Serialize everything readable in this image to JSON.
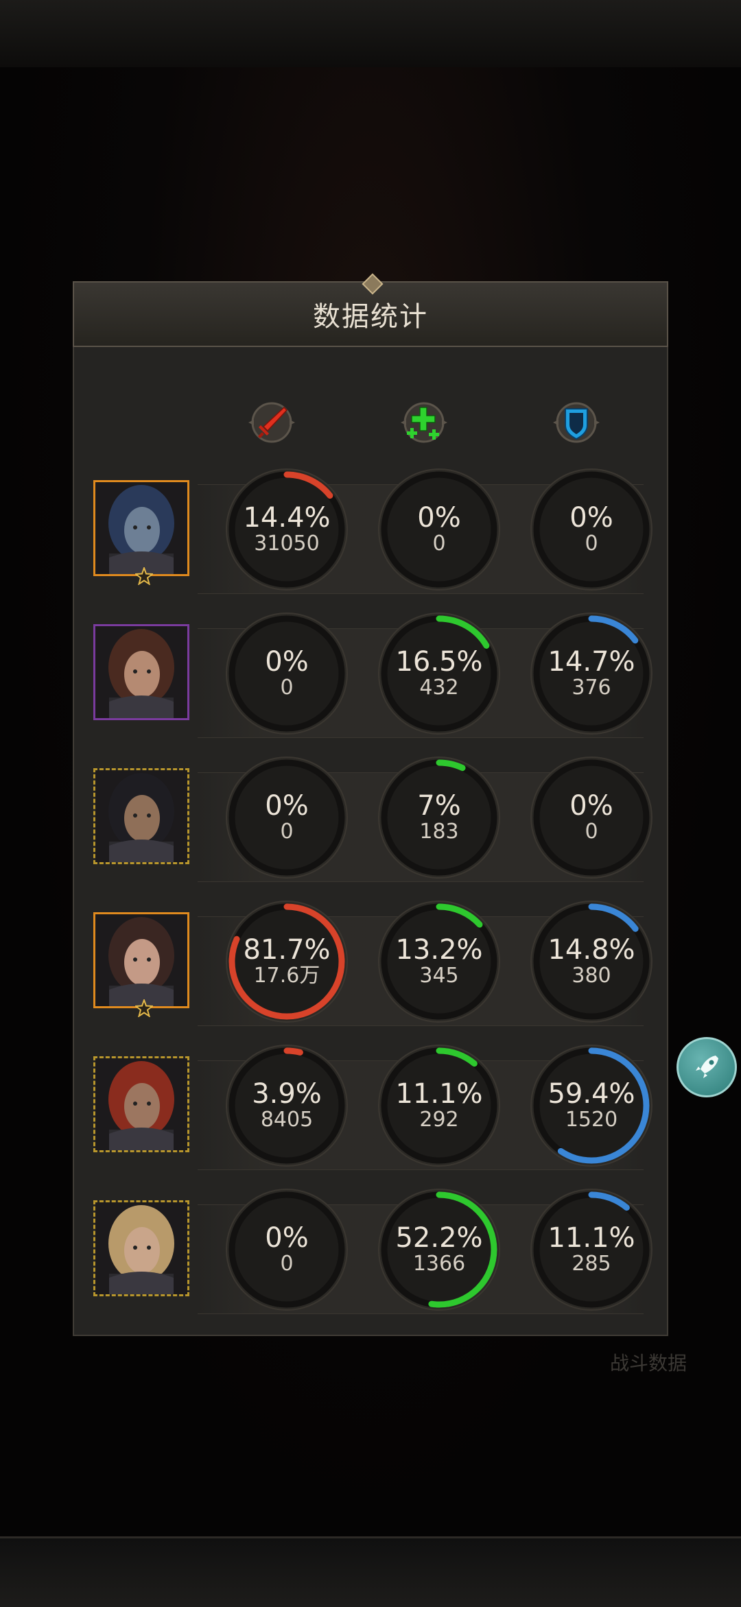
{
  "panel": {
    "title": "数据统计"
  },
  "columns": [
    {
      "name": "damage",
      "icon": "sword-icon",
      "color": "#d8432a"
    },
    {
      "name": "heal",
      "icon": "heal-plus-icon",
      "color": "#2ec82e"
    },
    {
      "name": "tank",
      "icon": "shield-icon",
      "color": "#3a86d6"
    }
  ],
  "background": {
    "battle_data_label": "战斗数据"
  },
  "heroes": [
    {
      "frame": "fire",
      "star": true,
      "hair": "#2a3a5a",
      "skin": "#6d7f95",
      "stats": [
        {
          "pct": "14.4%",
          "val": "31050",
          "frac": 0.144
        },
        {
          "pct": "0%",
          "val": "0",
          "frac": 0
        },
        {
          "pct": "0%",
          "val": "0",
          "frac": 0
        }
      ]
    },
    {
      "frame": "purple",
      "star": false,
      "hair": "#4a2a20",
      "skin": "#b58a72",
      "stats": [
        {
          "pct": "0%",
          "val": "0",
          "frac": 0
        },
        {
          "pct": "16.5%",
          "val": "432",
          "frac": 0.165
        },
        {
          "pct": "14.7%",
          "val": "376",
          "frac": 0.147
        }
      ]
    },
    {
      "frame": "dashed",
      "star": false,
      "hair": "#1e1d22",
      "skin": "#8f6f58",
      "stats": [
        {
          "pct": "0%",
          "val": "0",
          "frac": 0
        },
        {
          "pct": "7%",
          "val": "183",
          "frac": 0.07
        },
        {
          "pct": "0%",
          "val": "0",
          "frac": 0
        }
      ]
    },
    {
      "frame": "fire",
      "star": true,
      "hair": "#3a2622",
      "skin": "#c49a86",
      "stats": [
        {
          "pct": "81.7%",
          "val": "17.6万",
          "frac": 0.817
        },
        {
          "pct": "13.2%",
          "val": "345",
          "frac": 0.132
        },
        {
          "pct": "14.8%",
          "val": "380",
          "frac": 0.148
        }
      ]
    },
    {
      "frame": "dashed",
      "star": false,
      "hair": "#8a2c1e",
      "skin": "#9c7660",
      "stats": [
        {
          "pct": "3.9%",
          "val": "8405",
          "frac": 0.039
        },
        {
          "pct": "11.1%",
          "val": "292",
          "frac": 0.111
        },
        {
          "pct": "59.4%",
          "val": "1520",
          "frac": 0.594
        }
      ]
    },
    {
      "frame": "dashed",
      "star": false,
      "hair": "#b89a6a",
      "skin": "#c9a58a",
      "stats": [
        {
          "pct": "0%",
          "val": "0",
          "frac": 0
        },
        {
          "pct": "52.2%",
          "val": "1366",
          "frac": 0.522
        },
        {
          "pct": "11.1%",
          "val": "285",
          "frac": 0.111
        }
      ]
    }
  ]
}
